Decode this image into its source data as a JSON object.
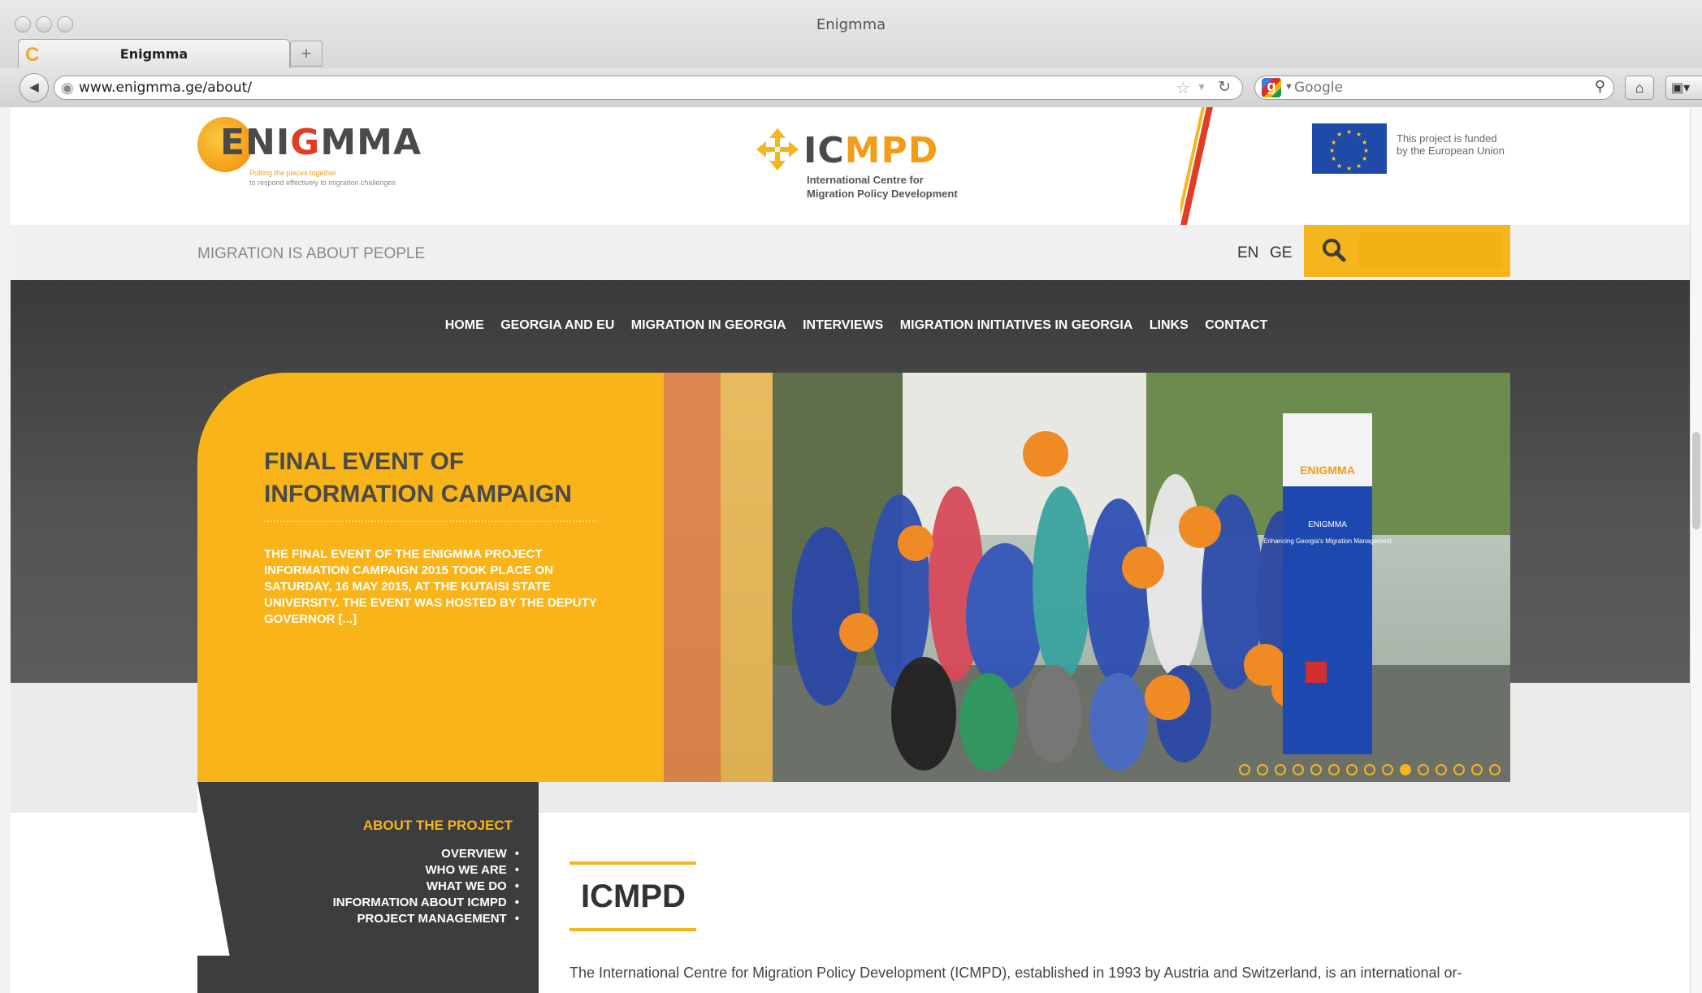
{
  "window": {
    "title": "Enigmma"
  },
  "tab": {
    "label": "Enigmma"
  },
  "navbar": {
    "url": "www.enigmma.ge/about/",
    "search_engine": "Google"
  },
  "header": {
    "enigmma_tagline_1": "Putting the pieces together",
    "enigmma_tagline_2": "to respond effectively to migration challenges",
    "icmpd_sub_1": "International Centre for",
    "icmpd_sub_2": "Migration Policy Development",
    "eu_text_1": "This project is funded",
    "eu_text_2": "by the European Union"
  },
  "utilbar": {
    "tagline": "MIGRATION IS ABOUT PEOPLE",
    "lang_en": "EN",
    "lang_ge": "GE",
    "search_value": ""
  },
  "mainnav": [
    "HOME",
    "GEORGIA AND EU",
    "MIGRATION IN GEORGIA",
    "INTERVIEWS",
    "MIGRATION INITIATIVES IN GEORGIA",
    "LINKS",
    "CONTACT"
  ],
  "slider": {
    "title_line1": "FINAL EVENT OF",
    "title_line2": "INFORMATION CAMPAIGN",
    "excerpt": "THE FINAL EVENT OF THE ENIGMMA PROJECT INFORMATION CAMPAIGN 2015 TOOK PLACE ON SATURDAY, 16 MAY 2015, AT THE KUTAISI STATE UNIVERSITY. THE EVENT WAS HOSTED BY THE DEPUTY GOVERNOR [...]",
    "dot_count": 15,
    "active_dot": 9,
    "banner_title": "ENIGMMA",
    "banner_sub": "Enhancing Georgia's Migration Management"
  },
  "sidebar": {
    "heading": "ABOUT THE PROJECT",
    "items": [
      "OVERVIEW",
      "WHO WE ARE",
      "WHAT WE DO",
      "INFORMATION ABOUT ICMPD",
      "PROJECT MANAGEMENT"
    ]
  },
  "content": {
    "title": "ICMPD",
    "text": "The International Centre for Migration Policy Development (ICMPD), established in 1993 by Austria and Switzerland, is an international or-"
  },
  "colors": {
    "accent": "#f5b51d",
    "dark": "#3d3d3d",
    "eu_blue": "#1f4aa8",
    "red": "#e23c26"
  }
}
